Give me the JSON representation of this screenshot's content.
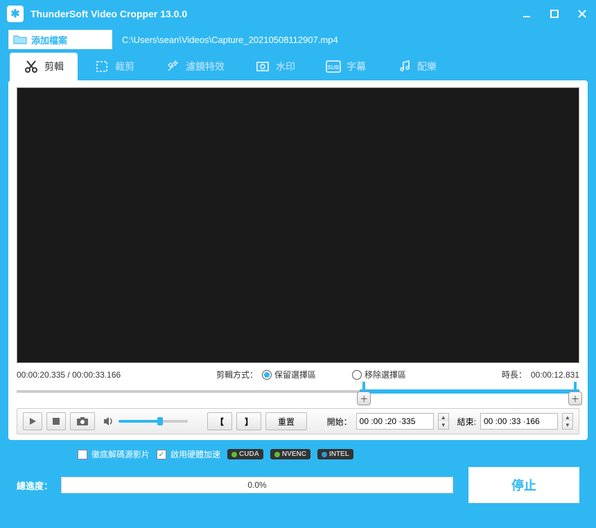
{
  "title": "ThunderSoft Video Cropper 13.0.0",
  "addFileLabel": "添加檔案",
  "filePath": "C:\\Users\\sean\\Videos\\Capture_20210508112907.mp4",
  "tabs": [
    {
      "label": "剪輯",
      "icon": "scissors",
      "active": true
    },
    {
      "label": "裁剪",
      "icon": "crop",
      "active": false
    },
    {
      "label": "濾鏡特效",
      "icon": "fx",
      "active": false
    },
    {
      "label": "水印",
      "icon": "watermark",
      "active": false
    },
    {
      "label": "字幕",
      "icon": "subtitle",
      "active": false
    },
    {
      "label": "配樂",
      "icon": "music",
      "active": false
    }
  ],
  "timeCurrent": "00:00:20.335",
  "timeTotal": "00:00:33.166",
  "trimModeLabel": "剪輯方式：",
  "keepLabel": "保留選擇區",
  "removeLabel": "移除選擇區",
  "trimModeSelected": "keep",
  "durationLabel": "時長：",
  "durationValue": "00:00:12.831",
  "resetLabel": "重置",
  "startLabel": "開始：",
  "startValue": "00 :00 :20 ·335",
  "endLabel": "結束:",
  "endValue": "00 :00 :33 ·166",
  "deepDecodeLabel": "徹底解碼源影片",
  "hwAccelLabel": "啟用硬體加速",
  "hwAccelChecked": true,
  "gpuBadges": [
    "CUDA",
    "NVENC",
    "INTEL"
  ],
  "progressLabel": "總進度：",
  "progressValue": "0.0%",
  "stopLabel": "停止"
}
